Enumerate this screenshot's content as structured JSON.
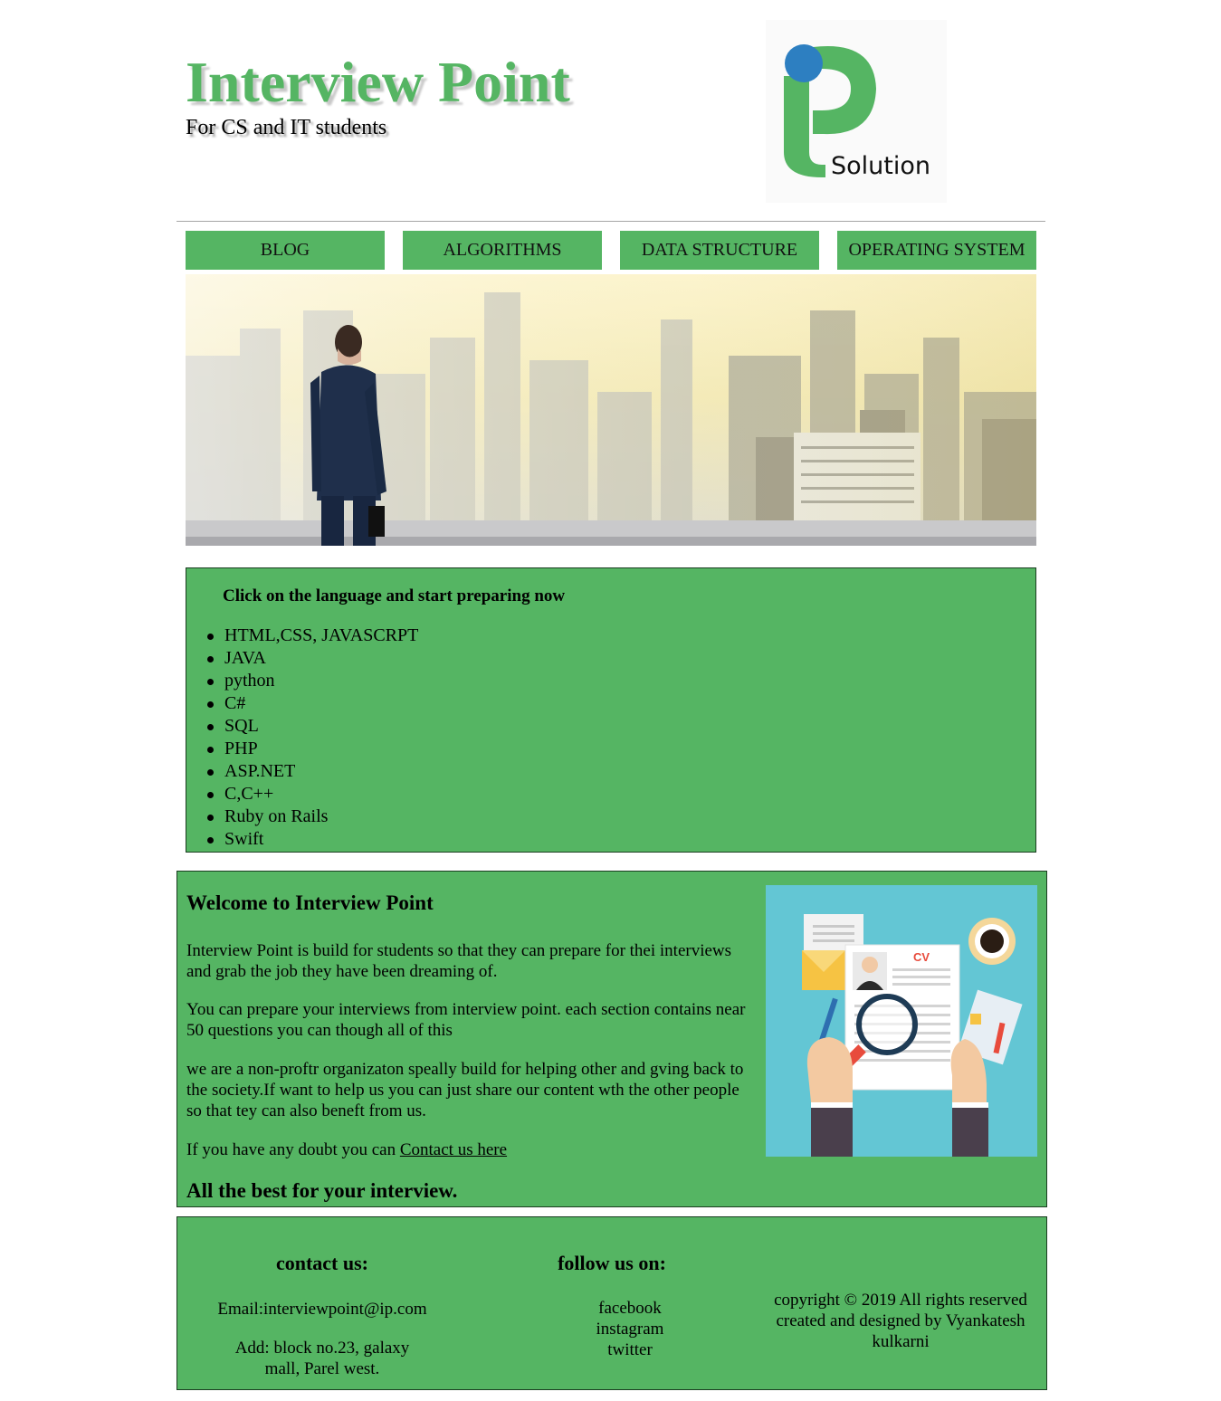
{
  "header": {
    "title": "Interview Point",
    "tagline": "For CS and IT students",
    "logo_text": "Solution",
    "logo_colors": {
      "green": "#55b563",
      "blue": "#2d7fc1"
    }
  },
  "nav": {
    "items": [
      "BLOG",
      "ALGORITHMS",
      "DATA STRUCTURE",
      "OPERATING SYSTEM"
    ]
  },
  "languages": {
    "heading": "Click on the language and start preparing now",
    "items": [
      "HTML,CSS, JAVASCRPT",
      "JAVA",
      "python",
      "C#",
      "SQL",
      "PHP",
      "ASP.NET",
      "C,C++",
      "Ruby on Rails",
      "Swift"
    ]
  },
  "welcome": {
    "title": "Welcome to Interview Point",
    "para1": "Interview Point is build for students so that they can prepare for thei interviews and grab the job they have been dreaming of.",
    "para2": "You can prepare your interviews from interview point. each section contains near 50 questions you can though all of this",
    "para3": "we are a non-proftr organizaton speally build for helping other and gving back to the society.If want to help us you can just share our content wth the other people so that tey can also beneft from us.",
    "doubt_text": "If you have any doubt you can ",
    "contact_link": "Contact us here",
    "closing": "All the best for your interview.",
    "cv_label": "CV"
  },
  "footer": {
    "contact_heading": "contact us:",
    "email": "Email:interviewpoint@ip.com",
    "address": "Add: block no.23, galaxy mall, Parel west.",
    "follow_heading": "follow us on:",
    "social": [
      "facebook",
      "instagram",
      "twitter"
    ],
    "copyright": "copyright © 2019 All rights reserved created and designed by Vyankatesh kulkarni"
  },
  "colors": {
    "brand_green": "#55b563",
    "illustration_bg": "#63c6d4"
  }
}
